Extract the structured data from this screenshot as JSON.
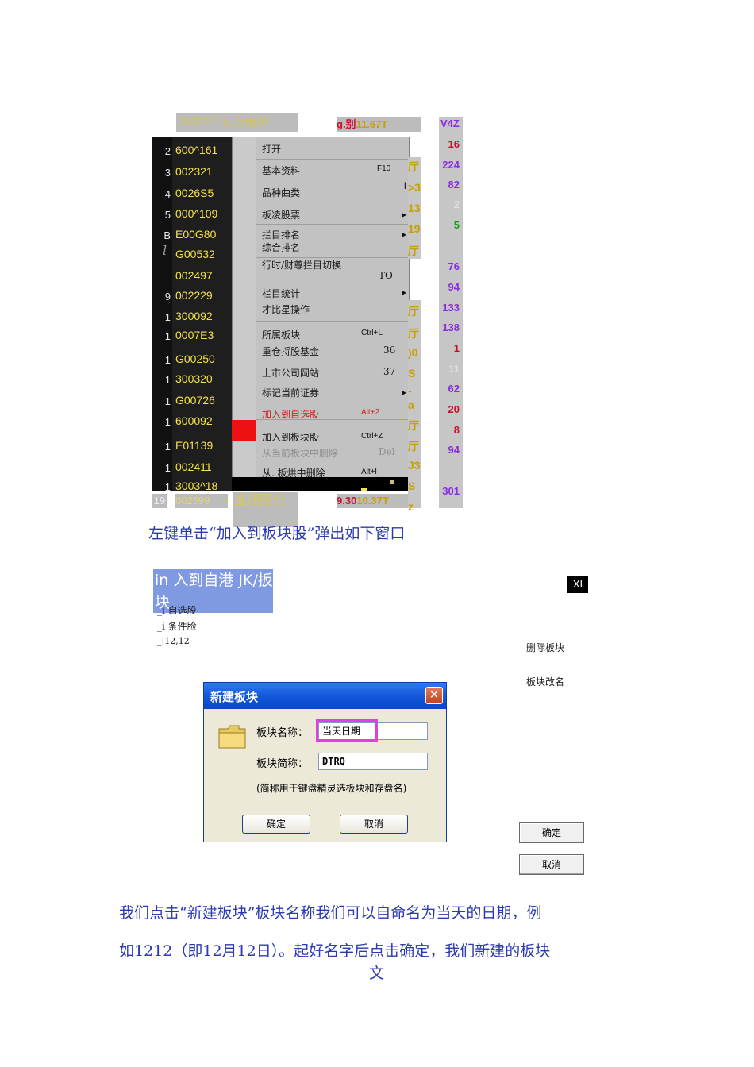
{
  "stock_header": {
    "code_name": "300217 东方电热",
    "price_a": "g.别",
    "price_b": "11.67T",
    "right_top": "V4Z"
  },
  "rows": [
    {
      "n": "2",
      "code": "600^161"
    },
    {
      "n": "3",
      "code": "002321"
    },
    {
      "n": "4",
      "code": "0026S5"
    },
    {
      "n": "5",
      "code": "000^109"
    },
    {
      "n": "B",
      "code": "E00G80"
    },
    {
      "n": "",
      "code": "G00532"
    },
    {
      "n": "",
      "code": "002497"
    },
    {
      "n": "9",
      "code": "002229"
    },
    {
      "n": "1",
      "code": "300092"
    },
    {
      "n": "1",
      "code": "0007E3"
    },
    {
      "n": "1",
      "code": "G00250"
    },
    {
      "n": "1",
      "code": "300320"
    },
    {
      "n": "1",
      "code": "G00726"
    },
    {
      "n": "1",
      "code": "600092"
    },
    {
      "n": "1",
      "code": "E01139"
    },
    {
      "n": "1",
      "code": "002411"
    },
    {
      "n": "1",
      "code": "3003^18"
    }
  ],
  "footer_row": {
    "n": "19",
    "code": "002599",
    "name": "盛通股份",
    "price_a": "9.30",
    "price_b": "10.37T"
  },
  "menu": {
    "marker_3": "3",
    "marker_1": "l",
    "open": "打开",
    "basic_info": "基本资料",
    "basic_info_key": "F10",
    "variety_curve": "品种曲类",
    "sector_stocks": "板凌股票",
    "column_rank": "拦目排名",
    "overall_rank": "综合排名",
    "switch_columns": "行时/财尊拦目切换",
    "switch_columns_key": "TO",
    "column_stats": "栏目统计",
    "compare_ops": "才比星操作",
    "belong_block": "所属板块",
    "belong_block_key": "Ctrl+L",
    "heavy_fund": "重仓捋股基金",
    "heavy_fund_key": "36",
    "company_site": "上市公司岡站",
    "company_site_key": "37",
    "mark_current": "标记当前证券",
    "add_favorites": "加入到自选股",
    "add_favorites_key": "Alt+2",
    "add_block": "加入到板块股",
    "add_block_key": "Ctrl+Z",
    "remove_current": "从当前板块中删除",
    "remove_current_key": "Del",
    "remove_from": "从. 板烘中删除",
    "remove_from_key": "Alt+l"
  },
  "strip_mid": [
    "厅",
    ">3",
    "13",
    "19",
    "厅"
  ],
  "strip_mid_marker": "I",
  "strip_low": [
    "厅",
    "厅",
    ")0",
    "S",
    "-",
    "a",
    "厅",
    "厅",
    "J3",
    "S",
    "z"
  ],
  "right_values": [
    {
      "v": "16",
      "c": "#c8102e"
    },
    {
      "v": "224",
      "c": "#8a2be2"
    },
    {
      "v": "82",
      "c": "#8a2be2"
    },
    {
      "v": "2",
      "c": "#dddddd"
    },
    {
      "v": "5",
      "c": "#1a9a1a"
    },
    {
      "v": "76",
      "c": "#8a2be2"
    },
    {
      "v": "94",
      "c": "#8a2be2"
    },
    {
      "v": "133",
      "c": "#8a2be2"
    },
    {
      "v": "138",
      "c": "#8a2be2"
    },
    {
      "v": "1",
      "c": "#c8102e"
    },
    {
      "v": "11",
      "c": "#dddddd"
    },
    {
      "v": "62",
      "c": "#8a2be2"
    },
    {
      "v": "20",
      "c": "#c8102e"
    },
    {
      "v": "8",
      "c": "#c8102e"
    },
    {
      "v": "94",
      "c": "#8a2be2"
    },
    {
      "v": "301",
      "c": "#8a2be2"
    }
  ],
  "caption1": "左键单击“加入到板块股”弹出如下窗口",
  "add_block_window": {
    "title": "in 入到自港 JK/扳块",
    "items": [
      "_i 自选股",
      "_i 条件脸",
      "_|12,12"
    ],
    "close_label": "XI",
    "delete_block": "删际板块",
    "rename_block": "板块改名",
    "ok": "确定",
    "cancel": "取消"
  },
  "dialog": {
    "title": "新建板块",
    "close": "✕",
    "name_label": "板块名称：",
    "name_value": "当天日期",
    "short_label": "板块简称：",
    "short_value": "DTRQ",
    "note": "(简称用于键盘精灵选板块和存盘名)",
    "ok": "确定",
    "cancel": "取消"
  },
  "paragraph": {
    "line1": "我们点击“新建板块”板块名称我们可以自命名为当天的日期，例",
    "line2": "如1212（即12月12日）。起好名字后点击确定，我们新建的板块",
    "line3": "文"
  },
  "colors": {
    "accent_blue": "#2b3ab0",
    "highlight_magenta": "#e040e0",
    "menu_red": "#ee1111"
  }
}
